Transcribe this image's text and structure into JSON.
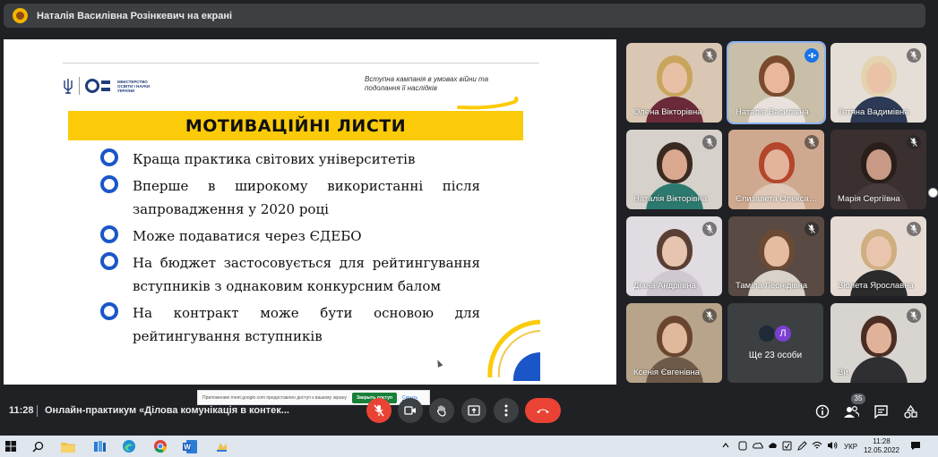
{
  "topbar": {
    "presenter_label": "Наталія Василівна Розінкевич на екрані"
  },
  "slide": {
    "ministry": "МІНІСТЕРСТВО ОСВІТИ І НАУКИ УКРАЇНИ",
    "ministry_abbr": "МОН",
    "campaign": "Вступна кампанія в умовах війни та подолання її наслідків",
    "title": "МОТИВАЦІЙНІ ЛИСТИ",
    "bullets": [
      "Краща практика світових університетів",
      "Вперше в широкому використанні після запровадження у 2020 році",
      "Може подаватися через ЄДЕБО",
      "На бюджет застосовується для рейтингування вступників з однаковим конкурсним балом",
      "На контракт може бути основою для рейтингування вступників"
    ],
    "notice": {
      "text": "Приложению meet.google.com предоставлен доступ к вашему экрану",
      "stop_button": "Закрыть доступ",
      "hide_link": "Скрыть"
    }
  },
  "participants": [
    {
      "name": "Олена Вікторівна",
      "bg": "#d9c7b4",
      "hair": "#c9a45c",
      "skin": "#e7c0a5",
      "cloth": "#6b2a3a"
    },
    {
      "name": "Наталія Василівна",
      "bg": "#c9bfa9",
      "hair": "#7a4a2e",
      "skin": "#e8b79c",
      "cloth": "#e9e2dc",
      "active": true
    },
    {
      "name": "Тетяна Вадимівна",
      "bg": "#e4ded6",
      "hair": "#e3d3b0",
      "skin": "#e9c2a8",
      "cloth": "#2d3a55"
    },
    {
      "name": "Наталія Вікторівна",
      "bg": "#d6d1ca",
      "hair": "#3a2a22",
      "skin": "#d9a88f",
      "cloth": "#2c7a6f"
    },
    {
      "name": "Єлизавета Олександрівна",
      "bg": "#cfa98f",
      "hair": "#b4462c",
      "skin": "#e3b39b",
      "cloth": "#e0c9b8"
    },
    {
      "name": "Марія Сергіївна",
      "bg": "#3a3030",
      "hair": "#2a1e1a",
      "skin": "#c89a86",
      "cloth": "#473c3c"
    },
    {
      "name": "Діана Андріївна",
      "bg": "#e1dbe2",
      "hair": "#5a4034",
      "skin": "#e7c4b0",
      "cloth": "#cfc8d0"
    },
    {
      "name": "Таміла Леонідівна",
      "bg": "#5a4a44",
      "hair": "#6b4a34",
      "skin": "#e5bba2",
      "cloth": "#d9d2c8"
    },
    {
      "name": "Віолета Ярославна",
      "bg": "#e6dbd3",
      "hair": "#cfae80",
      "skin": "#e9c5ad",
      "cloth": "#2b2b2b"
    },
    {
      "name": "Ксенія Євгенівна",
      "bg": "#b8a48a",
      "hair": "#6a4630",
      "skin": "#e0b89b",
      "cloth": "#6e5a48"
    },
    {
      "name": "Ви",
      "bg": "#d8d4cf",
      "hair": "#4a2e24",
      "skin": "#e1b29a",
      "cloth": "#2e2e33"
    }
  ],
  "more_tile": {
    "label": "Ще 23 особи",
    "avatar_letter": "Л"
  },
  "bottombar": {
    "time": "11:28",
    "meeting_title": "Онлайн-практикум «Ділова комунікація в контек...",
    "participant_count": "35"
  },
  "taskbar": {
    "language": "УКР",
    "clock_time": "11:28",
    "clock_date": "12.05.2022"
  },
  "colors": {
    "accent_blue": "#1a56c8",
    "banner_yellow": "#fbcb0a",
    "end_call_red": "#ea4335",
    "meet_dark": "#202124"
  }
}
